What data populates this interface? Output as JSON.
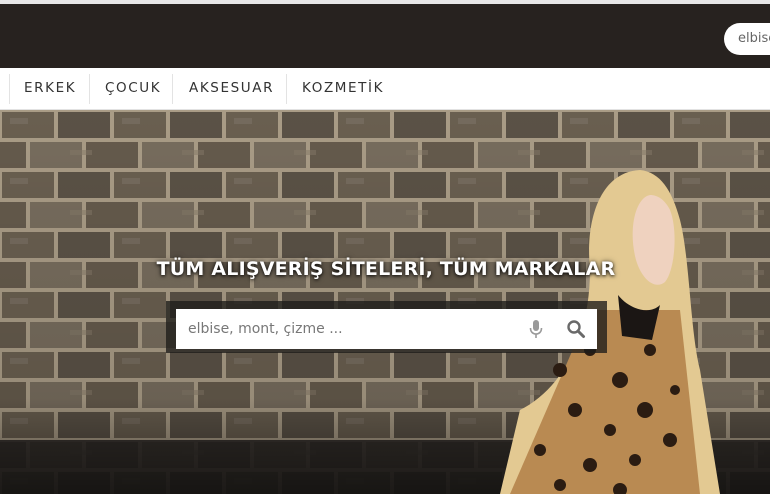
{
  "header": {
    "search_value": "elbise"
  },
  "nav": {
    "items": [
      {
        "label": "ERKEK"
      },
      {
        "label": "ÇOCUK"
      },
      {
        "label": "AKSESUAR"
      },
      {
        "label": "KOZMETİK"
      }
    ]
  },
  "hero": {
    "title": "TÜM ALIŞVERİŞ SİTELERİ, TÜM MARKALAR",
    "search_placeholder": "elbise, mont, çizme ...",
    "icons": [
      "microphone-icon",
      "search-icon"
    ]
  },
  "colors": {
    "header_bg": "#27221f",
    "nav_text": "#333333",
    "hero_bg": "#7b6f60"
  }
}
